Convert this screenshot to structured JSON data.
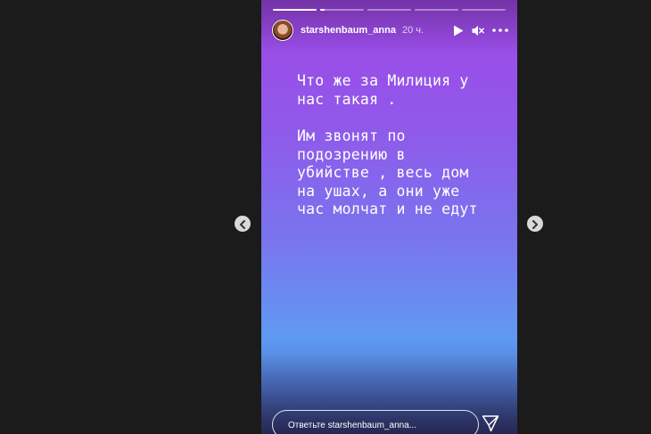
{
  "story": {
    "username": "starshenbaum_anna",
    "time_ago": "20 ч.",
    "progress": [
      1.0,
      0.1,
      0.0,
      0.0,
      0.0
    ],
    "text_paragraph1": [
      "Что же за Милиция у",
      "нас такая ."
    ],
    "text_paragraph2": [
      "Им звонят по",
      "подозрению в",
      "убийстве , весь дом",
      "на ушах, а они уже",
      "час молчат и не едут"
    ],
    "reply_placeholder": "Ответьте starshenbaum_anna..."
  },
  "icons": {
    "play": "play-icon",
    "mute": "speaker-muted-icon",
    "more": "more-horizontal-icon",
    "send": "paper-plane-icon",
    "prev": "chevron-left-icon",
    "next": "chevron-right-icon"
  },
  "colors": {
    "page_bg": "#1b1b1b",
    "story_top": "#a046e6",
    "story_bottom": "#3b3f78"
  }
}
